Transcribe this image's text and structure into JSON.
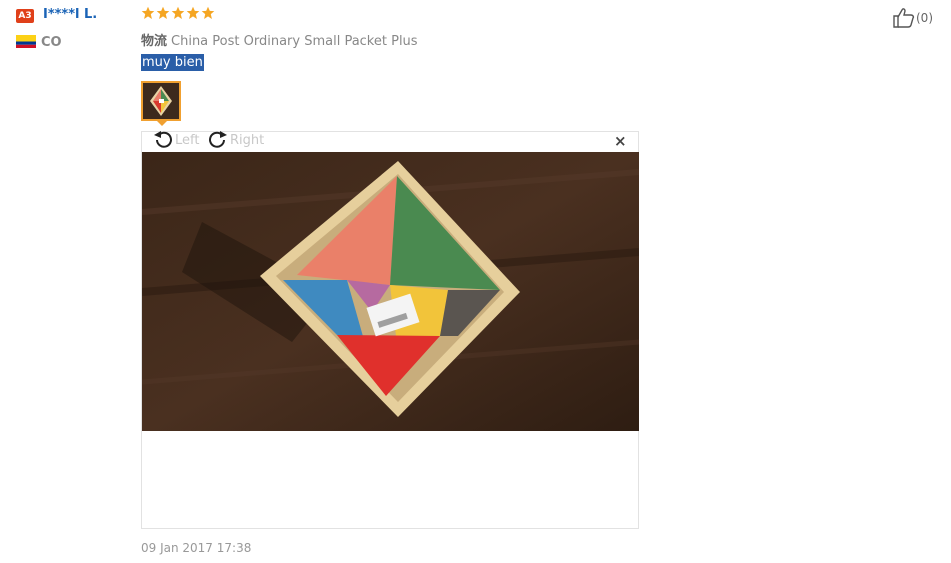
{
  "reviewer": {
    "level_badge": "A3",
    "name": "I****l L.",
    "country_code": "CO"
  },
  "review": {
    "rating": 5,
    "rating_max": 5,
    "shipping_label": "物流",
    "shipping_method": "China Post Ordinary Small Packet Plus",
    "text": "muy bien",
    "date": "09 Jan 2017 17:38"
  },
  "image_viewer": {
    "rotate_left_label": "Left",
    "rotate_right_label": "Right",
    "close_symbol": "×"
  },
  "helpful": {
    "count_text": "(0)"
  },
  "colors": {
    "star": "#f5a623",
    "username": "#1a63b6",
    "badge": "#e0401a",
    "highlight": "#2a5ea8"
  }
}
